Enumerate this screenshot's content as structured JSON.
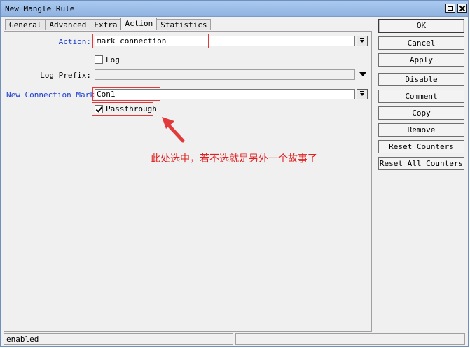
{
  "window": {
    "title": "New Mangle Rule"
  },
  "tabs": [
    {
      "label": "General"
    },
    {
      "label": "Advanced"
    },
    {
      "label": "Extra"
    },
    {
      "label": "Action"
    },
    {
      "label": "Statistics"
    }
  ],
  "active_tab": "Action",
  "form": {
    "action_label": "Action:",
    "action_value": "mark connection",
    "log_label": "Log",
    "log_checked": false,
    "log_prefix_label": "Log Prefix:",
    "log_prefix_value": "",
    "new_connection_mark_label": "New Connection Mark:",
    "new_connection_mark_value": "Con1",
    "passthrough_label": "Passthrough",
    "passthrough_checked": true
  },
  "buttons": {
    "ok": "OK",
    "cancel": "Cancel",
    "apply": "Apply",
    "disable": "Disable",
    "comment": "Comment",
    "copy": "Copy",
    "remove": "Remove",
    "reset_counters": "Reset Counters",
    "reset_all_counters": "Reset All Counters"
  },
  "annotation": {
    "text": "此处选中，若不选就是另外一个故事了",
    "color": "#e02020"
  },
  "status_bar": {
    "text": "enabled"
  },
  "colors": {
    "label_blue": "#1a3fd0",
    "highlight_red": "#e23a3a",
    "titlebar": "#9fc0ea"
  }
}
